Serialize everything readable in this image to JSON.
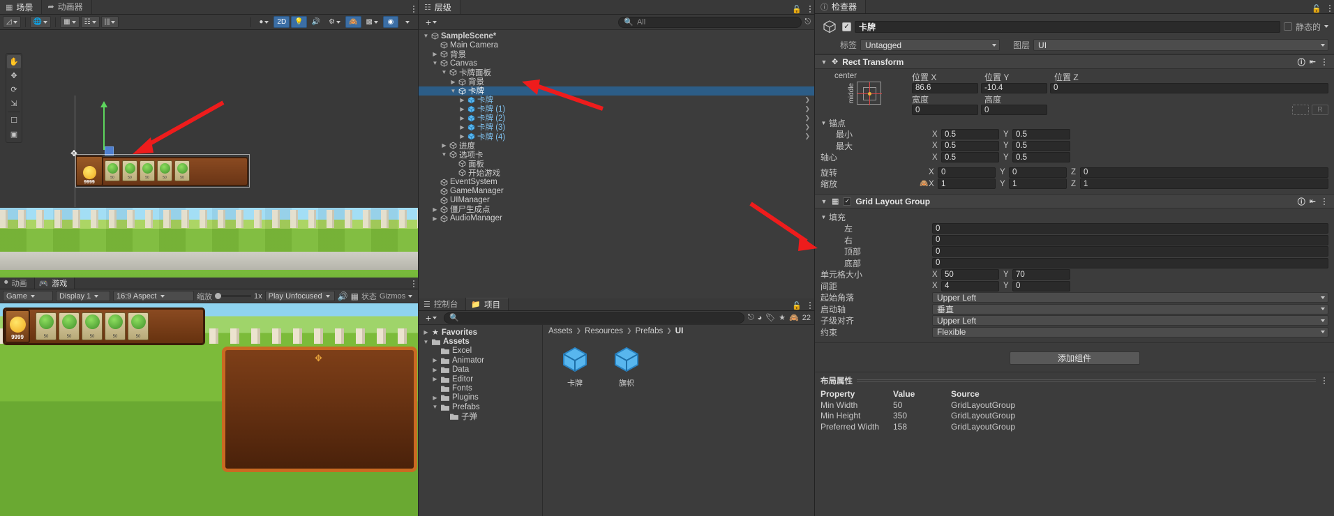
{
  "scene_panel": {
    "tabs": [
      {
        "label": "场景",
        "icon": "grid-icon",
        "active": true
      },
      {
        "label": "动画器",
        "icon": "animator-icon",
        "active": false
      }
    ],
    "toolbar": {
      "pivot_label": "",
      "mode_2d": "2D",
      "buttons": [
        "pivot-icon",
        "global-icon",
        "grid-snap-icon",
        "snap-increment-icon",
        "ruler-icon",
        "lighting-icon",
        "2D",
        "light-icon",
        "audio-icon",
        "fx-icon",
        "camera-icon",
        "gizmos-icon"
      ]
    },
    "tools": [
      "hand-tool",
      "move-tool",
      "rotate-tool",
      "scale-tool",
      "rect-tool",
      "transform-tool"
    ],
    "seed_cards": [
      {
        "cost": "50"
      },
      {
        "cost": "50"
      },
      {
        "cost": "50"
      },
      {
        "cost": "50"
      },
      {
        "cost": "50"
      }
    ],
    "sun_count": "9999"
  },
  "game_panel": {
    "tabs": [
      {
        "label": "动画",
        "icon": "animation-icon",
        "active": false
      },
      {
        "label": "游戏",
        "icon": "game-icon",
        "active": true
      }
    ],
    "toolbar": {
      "view": "Game",
      "display": "Display 1",
      "aspect": "16:9 Aspect",
      "scale_label": "缩放",
      "scale_value": "1x",
      "play_mode": "Play Unfocused",
      "mute_icon": "mute-audio-icon",
      "stats_label": "状态",
      "gizmos_label": "Gizmos"
    },
    "sun_count": "9999",
    "seed_cards": [
      {
        "cost": "50"
      },
      {
        "cost": "50"
      },
      {
        "cost": "50"
      },
      {
        "cost": "50"
      },
      {
        "cost": "50"
      }
    ]
  },
  "hierarchy": {
    "tab": {
      "label": "层级",
      "icon": "hierarchy-icon"
    },
    "create_label": "+",
    "search_placeholder": "All",
    "items": [
      {
        "label": "SampleScene*",
        "depth": 0,
        "tri": "down",
        "icon": "scene-icon",
        "bold": true,
        "selected": false,
        "prefab": false
      },
      {
        "label": "Main Camera",
        "depth": 1,
        "tri": "none",
        "icon": "gameobject-icon",
        "selected": false,
        "prefab": false
      },
      {
        "label": "背景",
        "depth": 1,
        "tri": "right",
        "icon": "gameobject-icon",
        "selected": false,
        "prefab": false
      },
      {
        "label": "Canvas",
        "depth": 1,
        "tri": "down",
        "icon": "gameobject-icon",
        "selected": false,
        "prefab": false
      },
      {
        "label": "卡牌面板",
        "depth": 2,
        "tri": "down",
        "icon": "gameobject-icon",
        "selected": false,
        "prefab": false
      },
      {
        "label": "背景",
        "depth": 3,
        "tri": "right",
        "icon": "gameobject-icon",
        "selected": false,
        "prefab": false
      },
      {
        "label": "卡牌",
        "depth": 3,
        "tri": "down",
        "icon": "gameobject-icon",
        "selected": true,
        "prefab": false
      },
      {
        "label": "卡牌",
        "depth": 4,
        "tri": "right",
        "icon": "prefab-icon",
        "selected": false,
        "prefab": true
      },
      {
        "label": "卡牌 (1)",
        "depth": 4,
        "tri": "right",
        "icon": "prefab-icon",
        "selected": false,
        "prefab": true
      },
      {
        "label": "卡牌 (2)",
        "depth": 4,
        "tri": "right",
        "icon": "prefab-icon",
        "selected": false,
        "prefab": true
      },
      {
        "label": "卡牌 (3)",
        "depth": 4,
        "tri": "right",
        "icon": "prefab-icon",
        "selected": false,
        "prefab": true
      },
      {
        "label": "卡牌 (4)",
        "depth": 4,
        "tri": "right",
        "icon": "prefab-icon",
        "selected": false,
        "prefab": true
      },
      {
        "label": "进度",
        "depth": 2,
        "tri": "right",
        "icon": "gameobject-icon",
        "selected": false,
        "prefab": false
      },
      {
        "label": "选项卡",
        "depth": 2,
        "tri": "down",
        "icon": "gameobject-icon",
        "selected": false,
        "prefab": false
      },
      {
        "label": "面板",
        "depth": 3,
        "tri": "none",
        "icon": "gameobject-icon",
        "selected": false,
        "prefab": false
      },
      {
        "label": "开始游戏",
        "depth": 3,
        "tri": "none",
        "icon": "gameobject-icon",
        "selected": false,
        "prefab": false
      },
      {
        "label": "EventSystem",
        "depth": 1,
        "tri": "none",
        "icon": "gameobject-icon",
        "selected": false,
        "prefab": false
      },
      {
        "label": "GameManager",
        "depth": 1,
        "tri": "none",
        "icon": "gameobject-icon",
        "selected": false,
        "prefab": false
      },
      {
        "label": "UIManager",
        "depth": 1,
        "tri": "none",
        "icon": "gameobject-icon",
        "selected": false,
        "prefab": false
      },
      {
        "label": "僵尸生成点",
        "depth": 1,
        "tri": "right",
        "icon": "gameobject-icon",
        "selected": false,
        "prefab": false
      },
      {
        "label": "AudioManager",
        "depth": 1,
        "tri": "right",
        "icon": "gameobject-icon",
        "selected": false,
        "prefab": false
      }
    ]
  },
  "project": {
    "tabs": [
      {
        "label": "控制台",
        "icon": "console-icon",
        "active": false
      },
      {
        "label": "项目",
        "icon": "project-icon",
        "active": true
      }
    ],
    "create_label": "+",
    "search_placeholder": "",
    "asset_count": "22",
    "tree": [
      {
        "label": "Favorites",
        "depth": 0,
        "tri": "right",
        "icon": "star-icon",
        "bold": true
      },
      {
        "label": "Assets",
        "depth": 0,
        "tri": "down",
        "icon": "folder-icon",
        "bold": true
      },
      {
        "label": "Excel",
        "depth": 1,
        "tri": "none",
        "icon": "folder-icon",
        "bold": false
      },
      {
        "label": "Animator",
        "depth": 1,
        "tri": "right",
        "icon": "folder-icon",
        "bold": false
      },
      {
        "label": "Data",
        "depth": 1,
        "tri": "right",
        "icon": "folder-icon",
        "bold": false
      },
      {
        "label": "Editor",
        "depth": 1,
        "tri": "right",
        "icon": "folder-icon",
        "bold": false
      },
      {
        "label": "Fonts",
        "depth": 1,
        "tri": "none",
        "icon": "folder-icon",
        "bold": false
      },
      {
        "label": "Plugins",
        "depth": 1,
        "tri": "right",
        "icon": "folder-icon",
        "bold": false
      },
      {
        "label": "Prefabs",
        "depth": 1,
        "tri": "down",
        "icon": "folder-icon",
        "bold": false
      },
      {
        "label": "子弹",
        "depth": 2,
        "tri": "none",
        "icon": "folder-icon",
        "bold": false
      }
    ],
    "breadcrumb": [
      "Assets",
      "Resources",
      "Prefabs",
      "UI"
    ],
    "assets": [
      {
        "label": "卡牌",
        "icon": "prefab-icon"
      },
      {
        "label": "旗帜",
        "icon": "prefab-icon"
      }
    ]
  },
  "inspector": {
    "tab": {
      "label": "检查器",
      "icon": "inspector-icon"
    },
    "object": {
      "enabled": true,
      "name": "卡牌",
      "static_label": "静态的",
      "static_checked": false,
      "tag_label": "标签",
      "tag_value": "Untagged",
      "layer_label": "图层",
      "layer_value": "UI"
    },
    "rect_transform": {
      "title": "Rect Transform",
      "anchor_preset_top": "center",
      "anchor_preset_side": "middle",
      "pos_x_label": "位置 X",
      "pos_x": "86.6",
      "pos_y_label": "位置 Y",
      "pos_y": "-10.4",
      "pos_z_label": "位置 Z",
      "pos_z": "0",
      "width_label": "宽度",
      "width": "0",
      "height_label": "高度",
      "height": "0",
      "anchors_label": "锚点",
      "min_label": "最小",
      "min_x": "0.5",
      "min_y": "0.5",
      "max_label": "最大",
      "max_x": "0.5",
      "max_y": "0.5",
      "pivot_label": "轴心",
      "pivot_x": "0.5",
      "pivot_y": "0.5",
      "rotation_label": "旋转",
      "rot_x": "0",
      "rot_y": "0",
      "rot_z": "0",
      "scale_label": "缩放",
      "scale_x": "1",
      "scale_y": "1",
      "scale_z": "1"
    },
    "grid_layout_group": {
      "title": "Grid Layout Group",
      "enabled": true,
      "padding_label": "填充",
      "left_label": "左",
      "left": "0",
      "right_label": "右",
      "right": "0",
      "top_label": "顶部",
      "top": "0",
      "bottom_label": "底部",
      "bottom": "0",
      "cell_size_label": "单元格大小",
      "cell_x": "50",
      "cell_y": "70",
      "spacing_label": "间距",
      "spacing_x": "4",
      "spacing_y": "0",
      "start_corner_label": "起始角落",
      "start_corner": "Upper Left",
      "start_axis_label": "启动轴",
      "start_axis": "垂直",
      "child_alignment_label": "子级对齐",
      "child_alignment": "Upper Left",
      "constraint_label": "约束",
      "constraint": "Flexible"
    },
    "add_component_label": "添加组件",
    "layout_properties": {
      "title": "布局属性",
      "columns": [
        "Property",
        "Value",
        "Source"
      ],
      "rows": [
        [
          "Min Width",
          "50",
          "GridLayoutGroup"
        ],
        [
          "Min Height",
          "350",
          "GridLayoutGroup"
        ],
        [
          "Preferred Width",
          "158",
          "GridLayoutGroup"
        ]
      ]
    }
  },
  "colors": {
    "accent_blue": "#2c5d87",
    "prefab_blue": "#80c2f0",
    "annotation_red": "#ee1c1c",
    "panel_bg": "#3c3c3c",
    "toolbar_bg": "#393939"
  }
}
